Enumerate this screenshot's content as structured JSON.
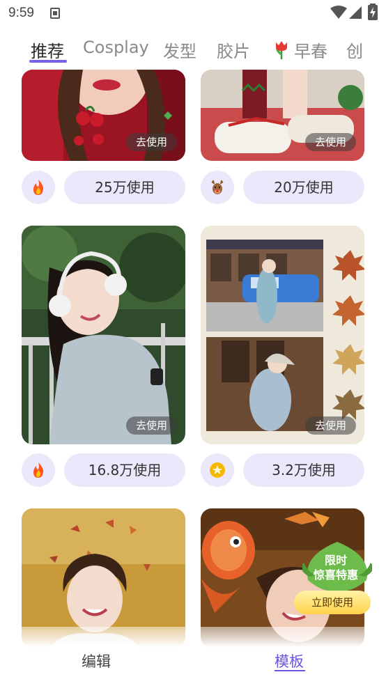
{
  "status_bar": {
    "time": "9:59",
    "icons": [
      "notification-icon",
      "wifi-icon",
      "signal-icon",
      "battery-charging-icon"
    ]
  },
  "tabs": [
    {
      "label": "推荐",
      "active": true
    },
    {
      "label": "Cosplay",
      "active": false
    },
    {
      "label": "发型",
      "active": false
    },
    {
      "label": "胶片",
      "active": false
    },
    {
      "label": "早春",
      "active": false,
      "icon": "tulip-icon"
    },
    {
      "label": "创",
      "active": false
    }
  ],
  "accent_color": "#7a62e6",
  "cards": [
    {
      "badge": "去使用",
      "emoji_icon": "fire-icon",
      "count": "25万使用"
    },
    {
      "badge": "去使用",
      "emoji_icon": "reindeer-icon",
      "count": "20万使用"
    },
    {
      "badge": "去使用",
      "emoji_icon": "fire-icon",
      "count": "16.8万使用"
    },
    {
      "badge": "去使用",
      "emoji_icon": "star-icon",
      "count": "3.2万使用"
    }
  ],
  "promo": {
    "line1": "限时",
    "line2": "惊喜特惠",
    "button": "立即使用"
  },
  "bottom_nav": [
    {
      "label": "编辑",
      "active": false
    },
    {
      "label": "模板",
      "active": true
    }
  ]
}
